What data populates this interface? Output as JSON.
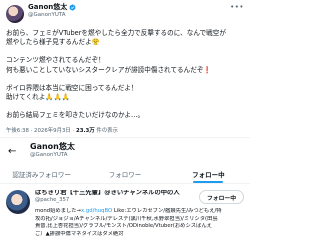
{
  "tweet": {
    "author_name": "Ganon悠太",
    "author_handle": "@GanonYUTA",
    "lines": [
      "お前ら、フェミがVTuberを燃やしたら全力で反撃するのに、なんで戦空が",
      "燃やしたら様子見するんだよ😤",
      "",
      "コンテンツ燃やされてるんだぞ！",
      "何も悪いことしていないシスタークレアが誹謗中傷されてるんだぞ❗",
      "",
      "ボイロ界隈は本当に戦空に困ってるんだよ！",
      "助けてくれよ🙏🙏🙏",
      "",
      "お前ら結局フェミを叩きたいだけなのかよ…。"
    ],
    "time": "午後6:38 · 2026年9月3日",
    "views_count": "23.3万",
    "views_label": "件の表示"
  },
  "profile": {
    "back_icon": "←",
    "name": "Ganon悠太",
    "handle": "@GanonYUTA"
  },
  "tabs": [
    {
      "label": "認証済みフォロワー",
      "active": false
    },
    {
      "label": "フォロワー",
      "active": false
    },
    {
      "label": "フォロー中",
      "active": true
    }
  ],
  "follower": {
    "name": "ぱちきり君【十三先輩】@きいチャンネルの中の人",
    "handle": "@pache_357",
    "button_label": "フォロー中",
    "bio_line1_prefix": "mond始めました→",
    "bio_link": "x.gd/huqBO",
    "bio_line1_suffix": " Like:エウレカセブン/艦娘先生/みつどもえ/特",
    "bio_line2": "攻の拓/ジョジョ/Aチャンネル/デレステ(黒川千秋,水野翠担当)/ミリシタ(田島",
    "bio_line3": "貴音,比上杏花担当)/グラブル/モンスト/ODinoble/Vtuber(おめシスぱんえ",
    "bio_line4": "ご）▲誹謗中傷マネタイズはダメ絶対"
  },
  "colors": {
    "accent": "#1d9bf0",
    "text": "#0f1419",
    "secondary_text": "#536471"
  }
}
